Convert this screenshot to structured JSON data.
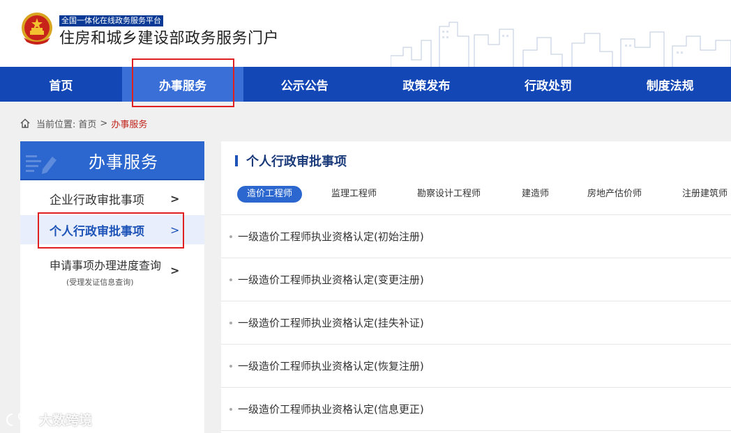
{
  "header": {
    "platform_tag": "全国一体化在线政务服务平台",
    "portal_title": "住房和城乡建设部政务服务门户"
  },
  "nav": {
    "items": [
      {
        "label": "首页"
      },
      {
        "label": "办事服务",
        "active": true
      },
      {
        "label": "公示公告"
      },
      {
        "label": "政策发布"
      },
      {
        "label": "行政处罚"
      },
      {
        "label": "制度法规"
      }
    ]
  },
  "breadcrumb": {
    "prefix": "当前位置:",
    "home": "首页",
    "separator": ">",
    "current": "办事服务"
  },
  "sidebar": {
    "title": "办事服务",
    "items": [
      {
        "label": "企业行政审批事项",
        "arrow": ">"
      },
      {
        "label": "个人行政审批事项",
        "arrow": ">",
        "active": true
      },
      {
        "label": "申请事项办理进度查询",
        "sublabel": "(受理发证信息查询)",
        "arrow": ">"
      }
    ]
  },
  "main": {
    "title": "个人行政审批事项",
    "tabs": [
      {
        "label": "造价工程师",
        "active": true
      },
      {
        "label": "监理工程师"
      },
      {
        "label": "勘察设计工程师"
      },
      {
        "label": "建造师"
      },
      {
        "label": "房地产估价师"
      },
      {
        "label": "注册建筑师"
      }
    ],
    "items": [
      "一级造价工程师执业资格认定(初始注册)",
      "一级造价工程师执业资格认定(变更注册)",
      "一级造价工程师执业资格认定(挂失补证)",
      "一级造价工程师执业资格认定(恢复注册)",
      "一级造价工程师执业资格认定(信息更正)"
    ]
  },
  "watermark": {
    "text": "大数跨境"
  },
  "colors": {
    "nav_bg": "#1347b5",
    "nav_active": "#3a6fd8",
    "sidebar_head": "#2b67cf",
    "tab_active": "#2b67cf",
    "breadcrumb_current": "#c0231b",
    "highlight": "#e02020"
  },
  "icons": {
    "breadcrumb": "home-icon",
    "header_emblem": "national-emblem-icon",
    "watermark": "watermark-logo-icon"
  }
}
